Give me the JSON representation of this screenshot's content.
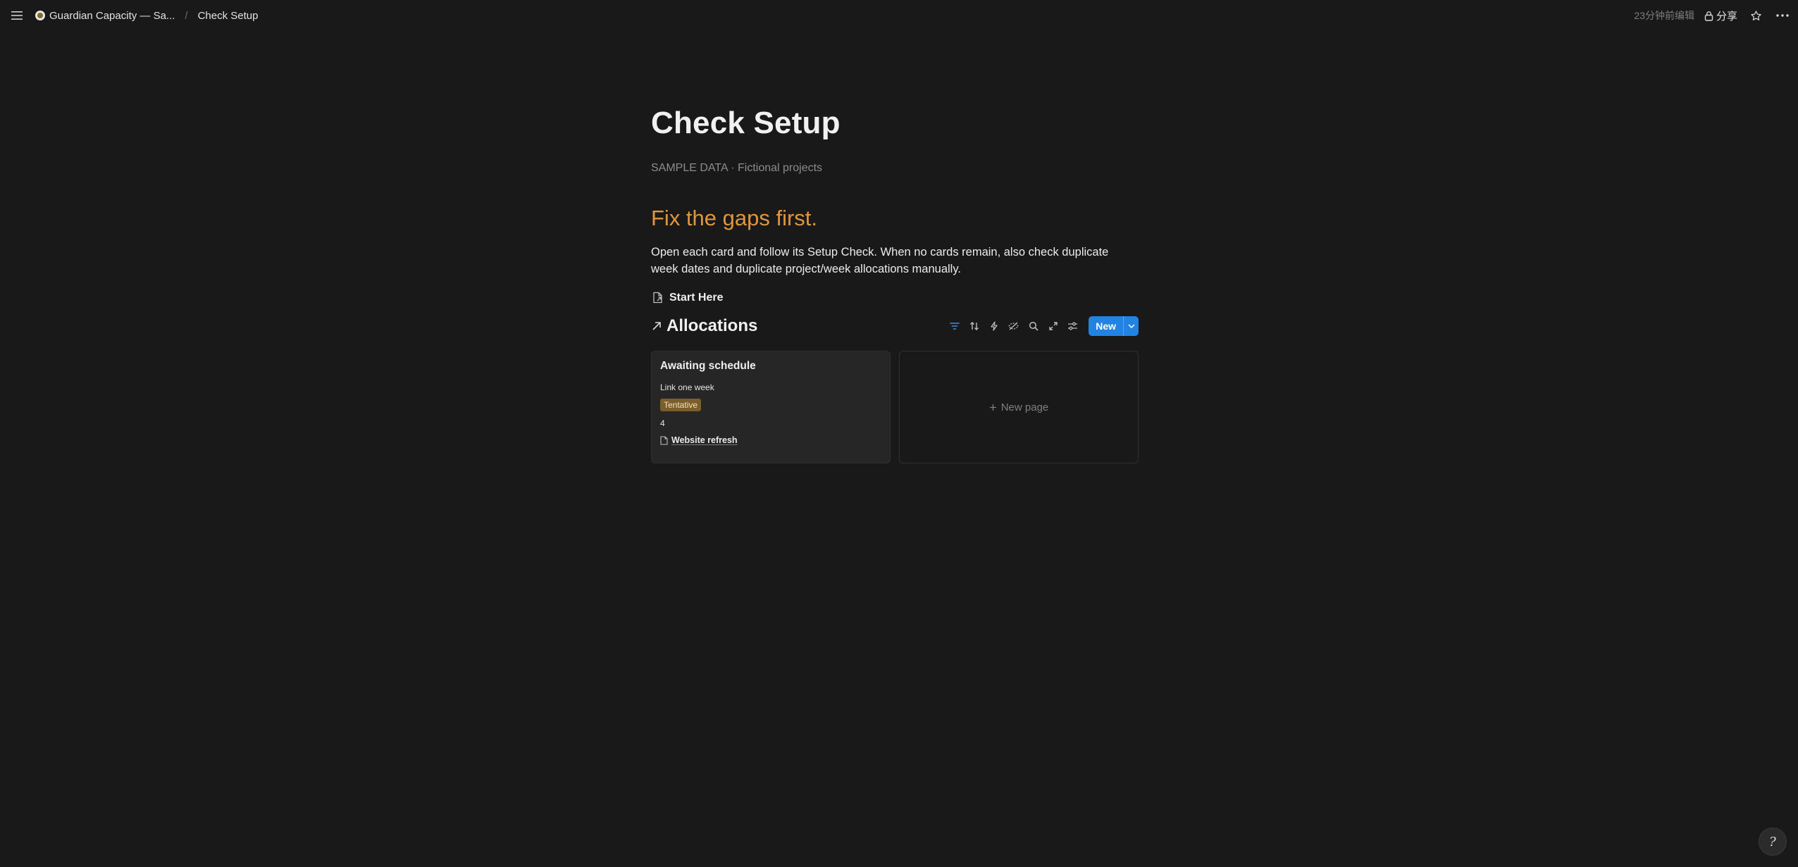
{
  "topbar": {
    "breadcrumbs": [
      {
        "label": "Guardian Capacity — Sa..."
      },
      {
        "label": "Check Setup"
      }
    ],
    "edited": "23分钟前编辑",
    "share_label": "分享"
  },
  "page": {
    "title": "Check Setup",
    "subtitle": "SAMPLE DATA · Fictional projects",
    "heading": "Fix the gaps first.",
    "paragraph": "Open each card and follow its Setup Check. When no cards remain, also check duplicate week dates and duplicate project/week allocations manually.",
    "link_label": "Start Here"
  },
  "database": {
    "title": "Allocations",
    "new_label": "New",
    "card": {
      "title": "Awaiting schedule",
      "line1": "Link one week",
      "tag": "Tentative",
      "number": "4",
      "project": "Website refresh"
    },
    "new_page_label": "New page"
  },
  "help": {
    "glyph": "?"
  },
  "colors": {
    "background": "#191919",
    "accent_heading": "#e0953f",
    "primary_button": "#2383e2",
    "tag_bg": "#7b5f2a"
  }
}
